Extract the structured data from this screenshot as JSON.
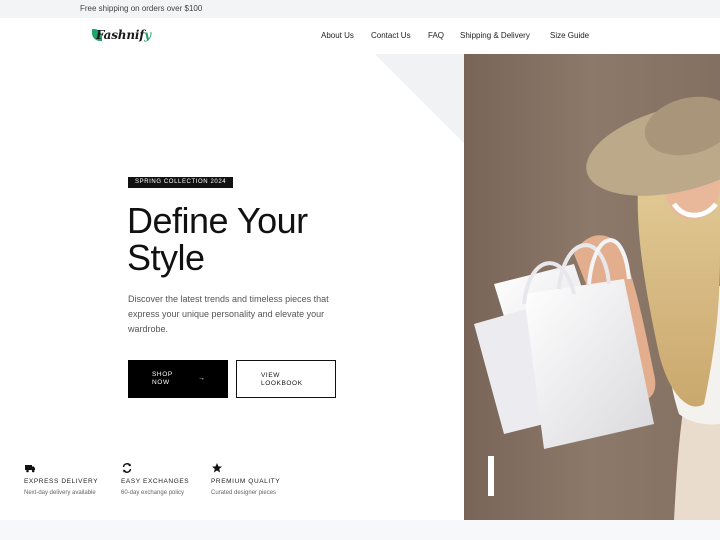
{
  "announcement": {
    "text": "Free shipping on orders over $100"
  },
  "brand": {
    "logo_main": "Fashnif",
    "logo_tail": "y",
    "accent": "#1fa36b"
  },
  "nav": {
    "items": [
      {
        "label": "About Us"
      },
      {
        "label": "Contact Us"
      },
      {
        "label": "FAQ"
      },
      {
        "label": "Shipping & Delivery"
      },
      {
        "label": "Size Guide"
      }
    ]
  },
  "hero": {
    "badge": "SPRING COLLECTION 2024",
    "title_line1": "Define Your",
    "title_line2": "Style",
    "description": "Discover the latest trends and timeless pieces that express your unique personality and elevate your wardrobe.",
    "primary_button": {
      "label": "SHOP NOW",
      "icon": "arrow-right-icon",
      "arrow": "→"
    },
    "secondary_button": {
      "label": "VIEW LOOKBOOK"
    },
    "image": {
      "icon": "model-photo"
    }
  },
  "features": [
    {
      "icon": "truck-icon",
      "title": "EXPRESS DELIVERY",
      "subtitle": "Next-day delivery available"
    },
    {
      "icon": "exchange-icon",
      "title": "EASY EXCHANGES",
      "subtitle": "60-day exchange policy"
    },
    {
      "icon": "star-icon",
      "title": "PREMIUM QUALITY",
      "subtitle": "Curated designer pieces"
    }
  ]
}
